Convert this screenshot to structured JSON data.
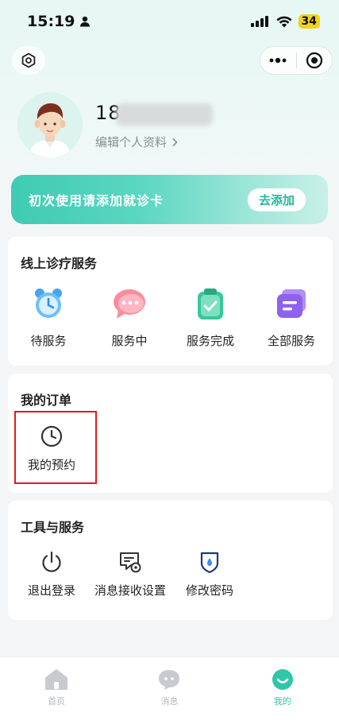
{
  "status_bar": {
    "time": "15:19",
    "battery": "34"
  },
  "profile": {
    "phone": "18",
    "edit_label": "编辑个人资料"
  },
  "banner": {
    "text": "初次使用请添加就诊卡",
    "button": "去添加"
  },
  "online_service": {
    "title": "线上诊疗服务",
    "items": [
      {
        "label": "待服务",
        "icon": "alarm-clock-icon"
      },
      {
        "label": "服务中",
        "icon": "chat-bubble-icon"
      },
      {
        "label": "服务完成",
        "icon": "clipboard-check-icon"
      },
      {
        "label": "全部服务",
        "icon": "card-stack-icon"
      }
    ]
  },
  "orders": {
    "title": "我的订单",
    "items": [
      {
        "label": "我的预约",
        "icon": "clock-icon"
      }
    ]
  },
  "tools": {
    "title": "工具与服务",
    "items": [
      {
        "label": "退出登录",
        "icon": "power-icon"
      },
      {
        "label": "消息接收设置",
        "icon": "message-settings-icon"
      },
      {
        "label": "修改密码",
        "icon": "shield-lock-icon"
      }
    ]
  },
  "tabbar": {
    "items": [
      {
        "label": "首页",
        "icon": "home-icon",
        "active": false
      },
      {
        "label": "消息",
        "icon": "message-icon",
        "active": false
      },
      {
        "label": "我的",
        "icon": "smile-icon",
        "active": true
      }
    ]
  },
  "colors": {
    "accent": "#2ec7a9",
    "highlight_box": "#e21a1a"
  }
}
